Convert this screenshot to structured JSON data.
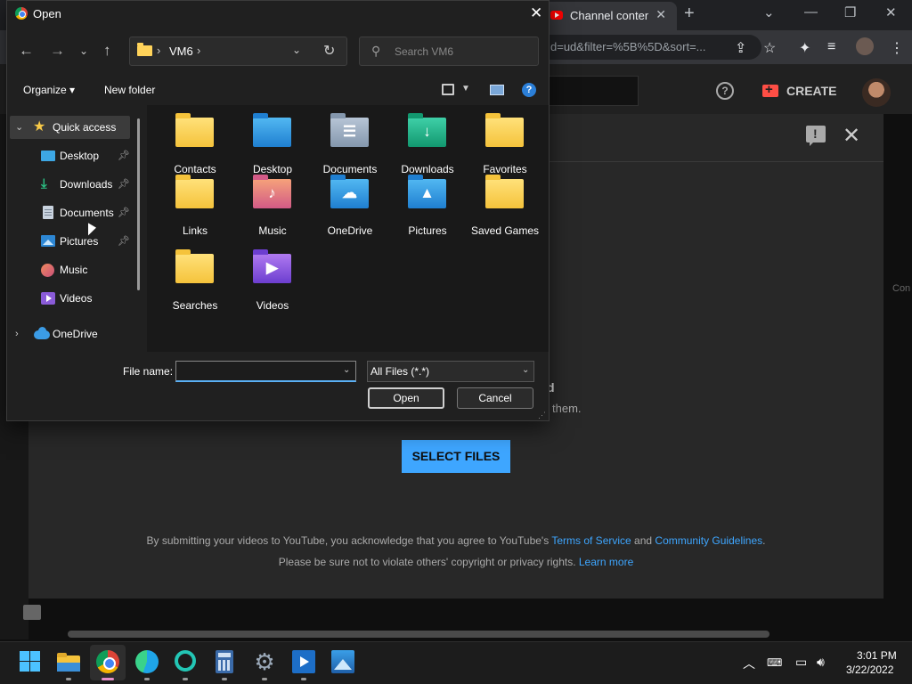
{
  "browser": {
    "tab_title": "Channel content",
    "url": "d=ud&filter=%5B%5D&sort=...",
    "new_tab_glyph": "+",
    "tab_close_glyph": "✕"
  },
  "youtube": {
    "create_label": "CREATE",
    "drag_title": "d",
    "drag_subtitle": "them.",
    "select_files_label": "SELECT FILES",
    "terms_prefix": "By submitting your videos to YouTube, you acknowledge that you agree to YouTube's ",
    "terms_link": "Terms of Service",
    "terms_and": " and ",
    "guidelines_link": "Community Guidelines",
    "terms_suffix": ".",
    "privacy_text": "Please be sure not to violate others' copyright or privacy rights. ",
    "learn_more_link": "Learn more",
    "edge_text": "Con",
    "help_glyph": "?"
  },
  "dialog": {
    "title": "Open",
    "address": {
      "current": "VM6"
    },
    "search_placeholder": "Search VM6",
    "organize_label": "Organize ▾",
    "new_folder_label": "New folder",
    "help_glyph": "?",
    "nav_pane": {
      "quick_access_label": "Quick access",
      "items": [
        {
          "label": "Desktop",
          "icon": "desktop-icon",
          "pinned": true
        },
        {
          "label": "Downloads",
          "icon": "downloads-icon",
          "pinned": true
        },
        {
          "label": "Documents",
          "icon": "documents-icon",
          "pinned": true
        },
        {
          "label": "Pictures",
          "icon": "pictures-icon",
          "pinned": true
        },
        {
          "label": "Music",
          "icon": "music-icon",
          "pinned": false
        },
        {
          "label": "Videos",
          "icon": "videos-icon",
          "pinned": false
        }
      ],
      "onedrive_label": "OneDrive"
    },
    "folders": [
      {
        "label": "Contacts",
        "icon": "contacts-folder-icon"
      },
      {
        "label": "Desktop",
        "icon": "desktop-folder-icon"
      },
      {
        "label": "Documents",
        "icon": "documents-folder-icon"
      },
      {
        "label": "Downloads",
        "icon": "downloads-folder-icon"
      },
      {
        "label": "Favorites",
        "icon": "favorites-folder-icon"
      },
      {
        "label": "Links",
        "icon": "links-folder-icon"
      },
      {
        "label": "Music",
        "icon": "music-folder-icon"
      },
      {
        "label": "OneDrive",
        "icon": "onedrive-folder-icon"
      },
      {
        "label": "Pictures",
        "icon": "pictures-folder-icon"
      },
      {
        "label": "Saved Games",
        "icon": "saved-games-folder-icon"
      },
      {
        "label": "Searches",
        "icon": "searches-folder-icon"
      },
      {
        "label": "Videos",
        "icon": "videos-folder-icon"
      }
    ],
    "file_name_label": "File name:",
    "file_name_value": "",
    "file_type_value": "All Files (*.*)",
    "open_label": "Open",
    "cancel_label": "Cancel"
  },
  "taskbar": {
    "time": "3:01 PM",
    "date": "3/22/2022"
  }
}
